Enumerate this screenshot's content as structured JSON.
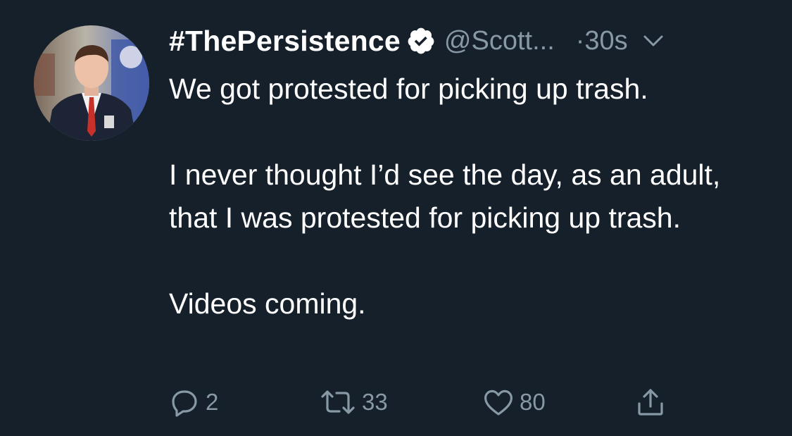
{
  "tweet": {
    "display_name": "#ThePersistence",
    "handle": "@Scott...",
    "time": "·30s",
    "verified": true,
    "avatar_icon": "profile-photo",
    "paragraphs": [
      "We got protested for picking up trash.",
      "I never thought I’d see the day, as an adult, that I was protested for picking up trash.",
      "Videos coming."
    ],
    "actions": {
      "reply_count": "2",
      "retweet_count": "33",
      "like_count": "80"
    }
  },
  "colors": {
    "background": "#15202b",
    "text": "#ffffff",
    "secondary": "#8899a6"
  }
}
